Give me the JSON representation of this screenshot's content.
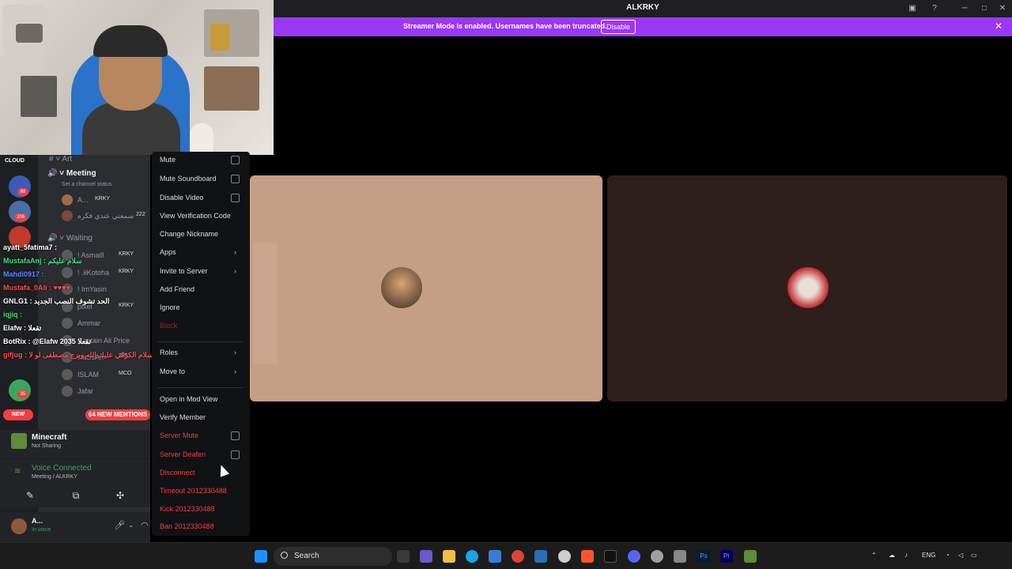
{
  "window": {
    "title": "ALKRKY"
  },
  "banner": {
    "text": "Streamer Mode is enabled. Usernames have been truncated.",
    "disable_label": "Disable",
    "close": "✕"
  },
  "guild_badges": [
    "88",
    "206",
    "35"
  ],
  "sidebar": {
    "category": "Art",
    "meeting_channel": "Meeting",
    "meeting_status": "Set a channel status",
    "meeting_members": [
      {
        "name": "A...",
        "tag": "KRKY"
      },
      {
        "name": "سمعني عندي فكره",
        "tag": "222"
      }
    ],
    "waiting_channel": "Waiting",
    "waiting_members": [
      {
        "name": "! Asmaill",
        "tag": "KRKY"
      },
      {
        "name": "! .iiKotoha",
        "tag": "KRKY"
      },
      {
        "name": "! ImYasin",
        "tag": ""
      },
      {
        "name": "pixel",
        "tag": "KRKY"
      },
      {
        "name": "Ammar",
        "tag": ""
      },
      {
        "name": "Captain Ali Price",
        "tag": ""
      },
      {
        "name": "HaSsAn",
        "tag": "385"
      },
      {
        "name": "ISLAM",
        "tag": "MCO"
      },
      {
        "name": "Jafar",
        "tag": ""
      }
    ],
    "new_label": "NEW",
    "new_mentions": "64 NEW MENTIONS"
  },
  "chat_overlay": [
    {
      "text": "ayatt_5fatima7 :",
      "color": "#ffffff"
    },
    {
      "text": "MustafaAnj : سلام عليكم",
      "color": "#3ee07a"
    },
    {
      "text": "Mahdi0917 :",
      "color": "#5b8cff"
    },
    {
      "text": "Mustafa_0Ali : ♥♥♥♥",
      "color": "#ff4d4d"
    },
    {
      "text": "GNLG1 : الحد تشوف النصب الجديد",
      "color": "#ffffff"
    },
    {
      "text": "iqjiq :",
      "color": "#3ee07a"
    },
    {
      "text": "Elafw : تقعلا",
      "color": "#ffffff"
    },
    {
      "text": "BotRix : @Elafw 2035 تقعلا",
      "color": "#ffffff"
    },
    {
      "text": "gifjug : سلام الكركي عليك الله وبرج مصطفى لو لا",
      "color": "#ff4d4d"
    }
  ],
  "activity": {
    "game": "Minecraft",
    "status": "Not Sharing"
  },
  "voice": {
    "status": "Voice Connected",
    "location": "Meeting / ALKRKY"
  },
  "user": {
    "name": "A...",
    "status": "In voice"
  },
  "context_menu": {
    "items": [
      {
        "label": "Mute",
        "style": "normal",
        "control": "checkbox"
      },
      {
        "label": "Mute Soundboard",
        "style": "normal",
        "control": "checkbox"
      },
      {
        "label": "Disable Video",
        "style": "normal",
        "control": "checkbox"
      },
      {
        "label": "View Verification Code",
        "style": "normal",
        "control": ""
      },
      {
        "label": "Change Nickname",
        "style": "normal",
        "control": ""
      },
      {
        "label": "Apps",
        "style": "normal",
        "control": "arrow"
      },
      {
        "label": "Invite to Server",
        "style": "normal",
        "control": "arrow"
      },
      {
        "label": "Add Friend",
        "style": "normal",
        "control": ""
      },
      {
        "label": "Ignore",
        "style": "normal",
        "control": ""
      },
      {
        "label": "Block",
        "style": "red-dim",
        "control": ""
      },
      {
        "label": "Roles",
        "style": "normal",
        "control": "arrow"
      },
      {
        "label": "Move to",
        "style": "normal",
        "control": "arrow"
      },
      {
        "label": "Open in Mod View",
        "style": "normal",
        "control": ""
      },
      {
        "label": "Verify Member",
        "style": "normal",
        "control": ""
      },
      {
        "label": "Server Mute",
        "style": "red",
        "control": "checkbox"
      },
      {
        "label": "Server Deafen",
        "style": "red",
        "control": "checkbox"
      },
      {
        "label": "Disconnect",
        "style": "red",
        "control": ""
      },
      {
        "label": "Timeout 2012330488",
        "style": "red",
        "control": ""
      },
      {
        "label": "Kick 2012330488",
        "style": "red",
        "control": ""
      },
      {
        "label": "Ban 2012330488",
        "style": "red",
        "control": ""
      }
    ]
  },
  "taskbar": {
    "search": "Search",
    "lang": "ENG"
  },
  "colors": {
    "accent": "#9b37f5",
    "danger": "#f23f43",
    "voice": "#3ba55d"
  }
}
